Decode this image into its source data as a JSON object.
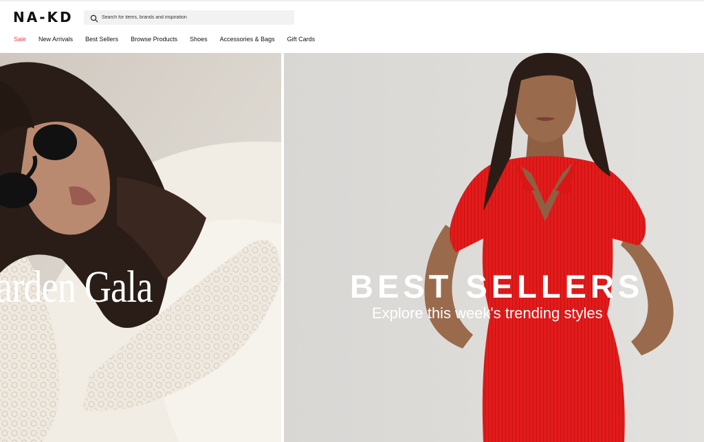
{
  "brand": {
    "logo_text": "NA-KD"
  },
  "search": {
    "placeholder": "Search for items, brands and inspiration"
  },
  "nav": {
    "items": [
      {
        "label": "Sale",
        "color": "#e8414a"
      },
      {
        "label": "New Arrivals"
      },
      {
        "label": "Best Sellers"
      },
      {
        "label": "Browse Products"
      },
      {
        "label": "Shoes"
      },
      {
        "label": "Accessories & Bags"
      },
      {
        "label": "Gift Cards"
      }
    ]
  },
  "hero_left": {
    "title": "arden Gala"
  },
  "hero_right": {
    "title": "BEST SELLERS",
    "subtitle": "Explore this week's trending styles"
  },
  "colors": {
    "accent_sale": "#e8414a",
    "dress_red": "#e21b1b"
  }
}
